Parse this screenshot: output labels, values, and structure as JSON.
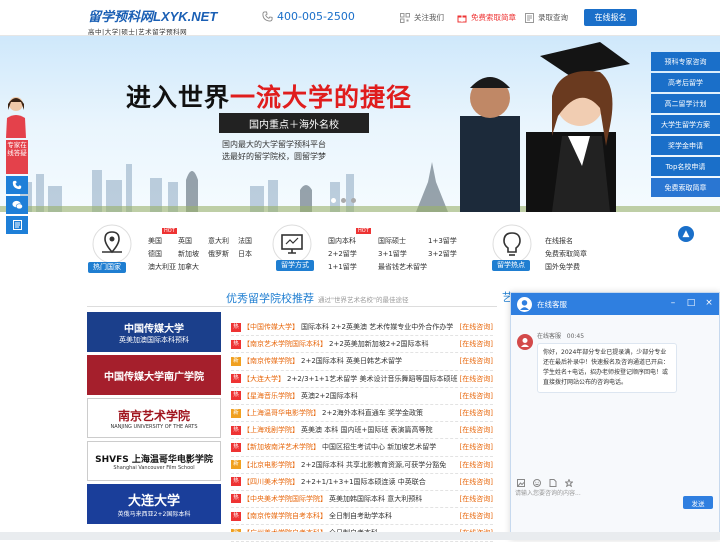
{
  "header": {
    "logo_main": "留学预科网LXYK.NET",
    "logo_sub": "高中|大学|硕士|艺术留学预科网",
    "phone": "400-005-2500",
    "follow": "关注我们",
    "free_brochure": "免费索取简章",
    "admission_query": "录取查询",
    "apply_online": "在线报名"
  },
  "banner": {
    "slogan_black": "进入世界",
    "slogan_red": "一流大学的捷径",
    "subtitle": "国内重点＋海外名校",
    "line1": "国内最大的大学留学预科平台",
    "line2": "选最好的留学院校，圆留学梦"
  },
  "right_nav": [
    "预科专家咨询",
    "高考后留学",
    "高二留学计划",
    "大学生留学方案",
    "奖学金申请",
    "Top名校申请",
    "免费索取简章"
  ],
  "left_float": {
    "service": "专家在线答疑"
  },
  "categories": {
    "popular_countries": {
      "tag": "热门国家",
      "items": [
        [
          "美国",
          "英国",
          "意大利",
          "法国"
        ],
        [
          "德国",
          "新加坡",
          "俄罗斯",
          "日本"
        ],
        [
          "澳大利亚",
          "加拿大"
        ]
      ]
    },
    "study_abroad": {
      "tag": "留学方式",
      "items": [
        [
          "国内本科",
          "国际硕士",
          "1+3留学"
        ],
        [
          "2+2留学",
          "3+1留学",
          "3+2留学"
        ],
        [
          "1+1留学",
          "最省钱艺术留学"
        ]
      ]
    },
    "hot_topics": {
      "tag": "留学热点",
      "items": [
        "在线报名",
        "免费索取简章",
        "国外免学费"
      ]
    }
  },
  "section": {
    "title": "优秀留学院校推荐",
    "subtitle": "通过\"世界艺术名校\"的最佳途径",
    "partial": "艺"
  },
  "tiles": [
    {
      "name": "中国传媒大学",
      "sub": "英美加澳国际本科预科"
    },
    {
      "name": "中国传媒大学南广学院",
      "sub": ""
    },
    {
      "name": "南京艺术学院",
      "sub": "NANJING UNIVERSITY OF THE ARTS"
    },
    {
      "name": "SHVFS 上海温哥华电影学院",
      "sub": "Shanghai Vancouver Film School"
    },
    {
      "name": "大连大学",
      "sub": "英俄马来西亚2+2国际本科"
    }
  ],
  "list": [
    {
      "tag": "热",
      "school": "【中国传媒大学】",
      "prog": "国际本科 2+2英美澳 艺术传媒专业中外合作办学"
    },
    {
      "tag": "热",
      "school": "【南京艺术学院国际本科】",
      "prog": "2+2英美加新加坡2+2国际本科"
    },
    {
      "tag": "新",
      "school": "【南京传媒学院】",
      "prog": "2+2国际本科 英美日韩艺术留学"
    },
    {
      "tag": "热",
      "school": "【大连大学】",
      "prog": "2+2/3+1+1艺术留学 美术设计音乐舞蹈等国际本硕班"
    },
    {
      "tag": "热",
      "school": "【星海音乐学院】",
      "prog": "英澳2+2国际本科"
    },
    {
      "tag": "新",
      "school": "【上海温哥华电影学院】",
      "prog": "2+2海外本科直通车 奖学金政策"
    },
    {
      "tag": "热",
      "school": "【上海戏剧学院】",
      "prog": "英美澳 本科 国内班+国际班 表演篇高等院"
    },
    {
      "tag": "热",
      "school": "【新加坡南洋艺术学院】",
      "prog": "中国区招生考试中心 新加坡艺术留学"
    },
    {
      "tag": "新",
      "school": "【北京电影学院】",
      "prog": "2+2国际本科 共享北影教育资源,可获学分豁免"
    },
    {
      "tag": "热",
      "school": "【四川美术学院】",
      "prog": "2+2+1/1+3+1国际本硕连读 中英联合"
    },
    {
      "tag": "热",
      "school": "【中央美术学院国际学院】",
      "prog": "英美加韩国际本科 意大利预科"
    },
    {
      "tag": "热",
      "school": "【南京传媒学院自考本科】",
      "prog": "全日制自考助学本科"
    },
    {
      "tag": "新",
      "school": "【广州美术学院自考本科】",
      "prog": "全日制自考本科"
    }
  ],
  "list_consult": "[在线咨询]",
  "chat": {
    "title": "在线客服",
    "agent": "在线客服",
    "time": "00:45",
    "message": "你好，2024年部分专业已提录满，少部分专业还在最后补录中！快速报名及咨询通道已开启：学生姓名+电话，招办老师按登记顺序回电！或直接拨打网站公布的咨询电话。",
    "placeholder": "请输入您要咨询的内容...",
    "send": "发送"
  },
  "colors": {
    "brand": "#1a6fc9",
    "accent_red": "#e01d1d",
    "hot_tag": "#e33333",
    "consult": "#e86a10"
  }
}
